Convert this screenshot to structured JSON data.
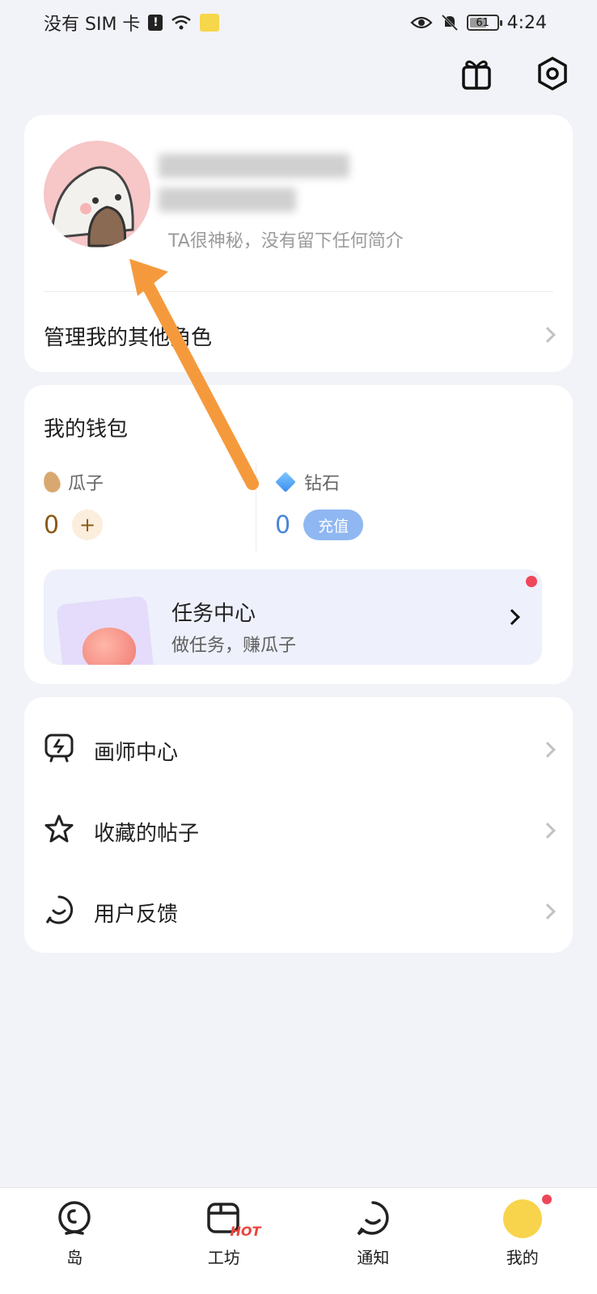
{
  "status_bar": {
    "carrier": "没有 SIM 卡",
    "alert_badge": "!",
    "battery": "61",
    "battery_level": 0.61,
    "time": "4:24"
  },
  "profile": {
    "bio": "TA很神秘，没有留下任何简介",
    "manage_roles": "管理我的其他角色"
  },
  "wallet": {
    "title": "我的钱包",
    "seeds": {
      "label": "瓜子",
      "value": "0",
      "add": "+"
    },
    "diamonds": {
      "label": "钻石",
      "value": "0",
      "recharge": "充值"
    },
    "task_center": {
      "title": "任务中心",
      "subtitle": "做任务，赚瓜子"
    }
  },
  "menu": [
    {
      "label": "画师中心",
      "icon": "artist-center-icon"
    },
    {
      "label": "收藏的帖子",
      "icon": "star-icon"
    },
    {
      "label": "用户反馈",
      "icon": "feedback-icon"
    }
  ],
  "tabs": [
    {
      "label": "岛",
      "icon": "island-icon"
    },
    {
      "label": "工坊",
      "icon": "workshop-icon",
      "badge": "HOT"
    },
    {
      "label": "通知",
      "icon": "notification-icon"
    },
    {
      "label": "我的",
      "icon": "me-avatar-icon",
      "active": true
    }
  ],
  "colors": {
    "background": "#f2f3f8",
    "accent_blue": "#8fb7f2",
    "seed_value": "#8a5a16",
    "diamond_value": "#4a86d8",
    "notice_red": "#f0465a",
    "annotation_arrow": "#f59a3c"
  }
}
